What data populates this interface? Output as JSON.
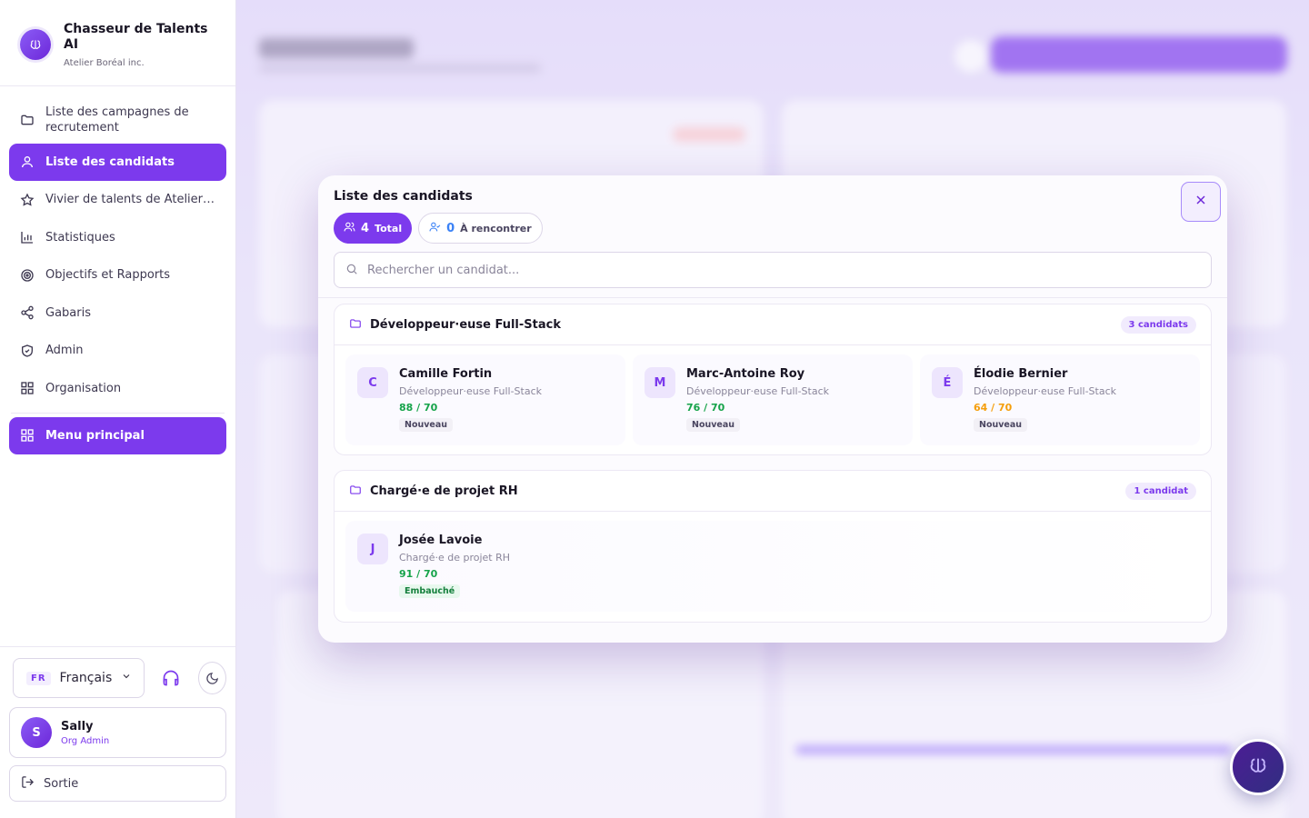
{
  "brand": {
    "name": "Chasseur de Talents AI",
    "company": "Atelier Boréal inc."
  },
  "nav": [
    {
      "label": "Liste des campagnes de recrutement",
      "icon": "folder-icon",
      "active": false
    },
    {
      "label": "Liste des candidats",
      "icon": "user-icon",
      "active": true
    },
    {
      "label": "Vivier de talents de Atelier…",
      "icon": "star-icon",
      "active": false
    },
    {
      "label": "Statistiques",
      "icon": "bar-chart-icon",
      "active": false
    },
    {
      "label": "Objectifs et Rapports",
      "icon": "target-icon",
      "active": false
    },
    {
      "label": "Gabaris",
      "icon": "share-icon",
      "active": false
    },
    {
      "label": "Admin",
      "icon": "shield-icon",
      "active": false
    },
    {
      "label": "Organisation",
      "icon": "grid-icon",
      "active": false
    }
  ],
  "main_menu": {
    "label": "Menu principal"
  },
  "language": {
    "code": "FR",
    "label": "Français"
  },
  "user": {
    "initial": "S",
    "name": "Sally",
    "role": "Org Admin"
  },
  "logout": {
    "label": "Sortie"
  },
  "modal": {
    "title": "Liste des candidats",
    "chip_total": {
      "count": "4",
      "label": "Total"
    },
    "chip_meet": {
      "count": "0",
      "label": "À rencontrer"
    },
    "search_placeholder": "Rechercher un candidat...",
    "groups": [
      {
        "name": "Développeur·euse Full-Stack",
        "count_label": "3 candidats",
        "candidates": [
          {
            "initial": "C",
            "name": "Camille Fortin",
            "job": "Développeur·euse Full-Stack",
            "score": "88 / 70",
            "score_color": "#16a34a",
            "status": "Nouveau"
          },
          {
            "initial": "M",
            "name": "Marc-Antoine Roy",
            "job": "Développeur·euse Full-Stack",
            "score": "76 / 70",
            "score_color": "#16a34a",
            "status": "Nouveau"
          },
          {
            "initial": "É",
            "name": "Élodie Bernier",
            "job": "Développeur·euse Full-Stack",
            "score": "64 / 70",
            "score_color": "#f59e0b",
            "status": "Nouveau"
          }
        ]
      },
      {
        "name": "Chargé·e de projet RH",
        "count_label": "1 candidat",
        "candidates": [
          {
            "initial": "J",
            "name": "Josée Lavoie",
            "job": "Chargé·e de projet RH",
            "score": "91 / 70",
            "score_color": "#16a34a",
            "status": "Embauché"
          }
        ]
      }
    ]
  }
}
